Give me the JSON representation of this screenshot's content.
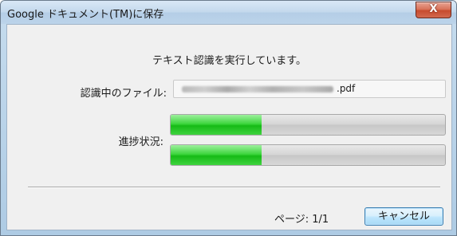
{
  "window": {
    "title": "Google ドキュメント(TM)に保存",
    "close_symbol": "X"
  },
  "dialog": {
    "status_message": "テキスト認識を実行しています。",
    "file_label": "認識中のファイル:",
    "file_extension": ".pdf",
    "progress_label": "進捗状況:",
    "progress": [
      {
        "fraction": 0.33
      },
      {
        "fraction": 0.33
      }
    ],
    "page_text": "ページ: 1/1",
    "cancel_label": "キャンセル"
  },
  "colors": {
    "progress_fill": "#2ccb2c",
    "close_button": "#c74b2e",
    "titlebar": "#bcd4ea"
  }
}
